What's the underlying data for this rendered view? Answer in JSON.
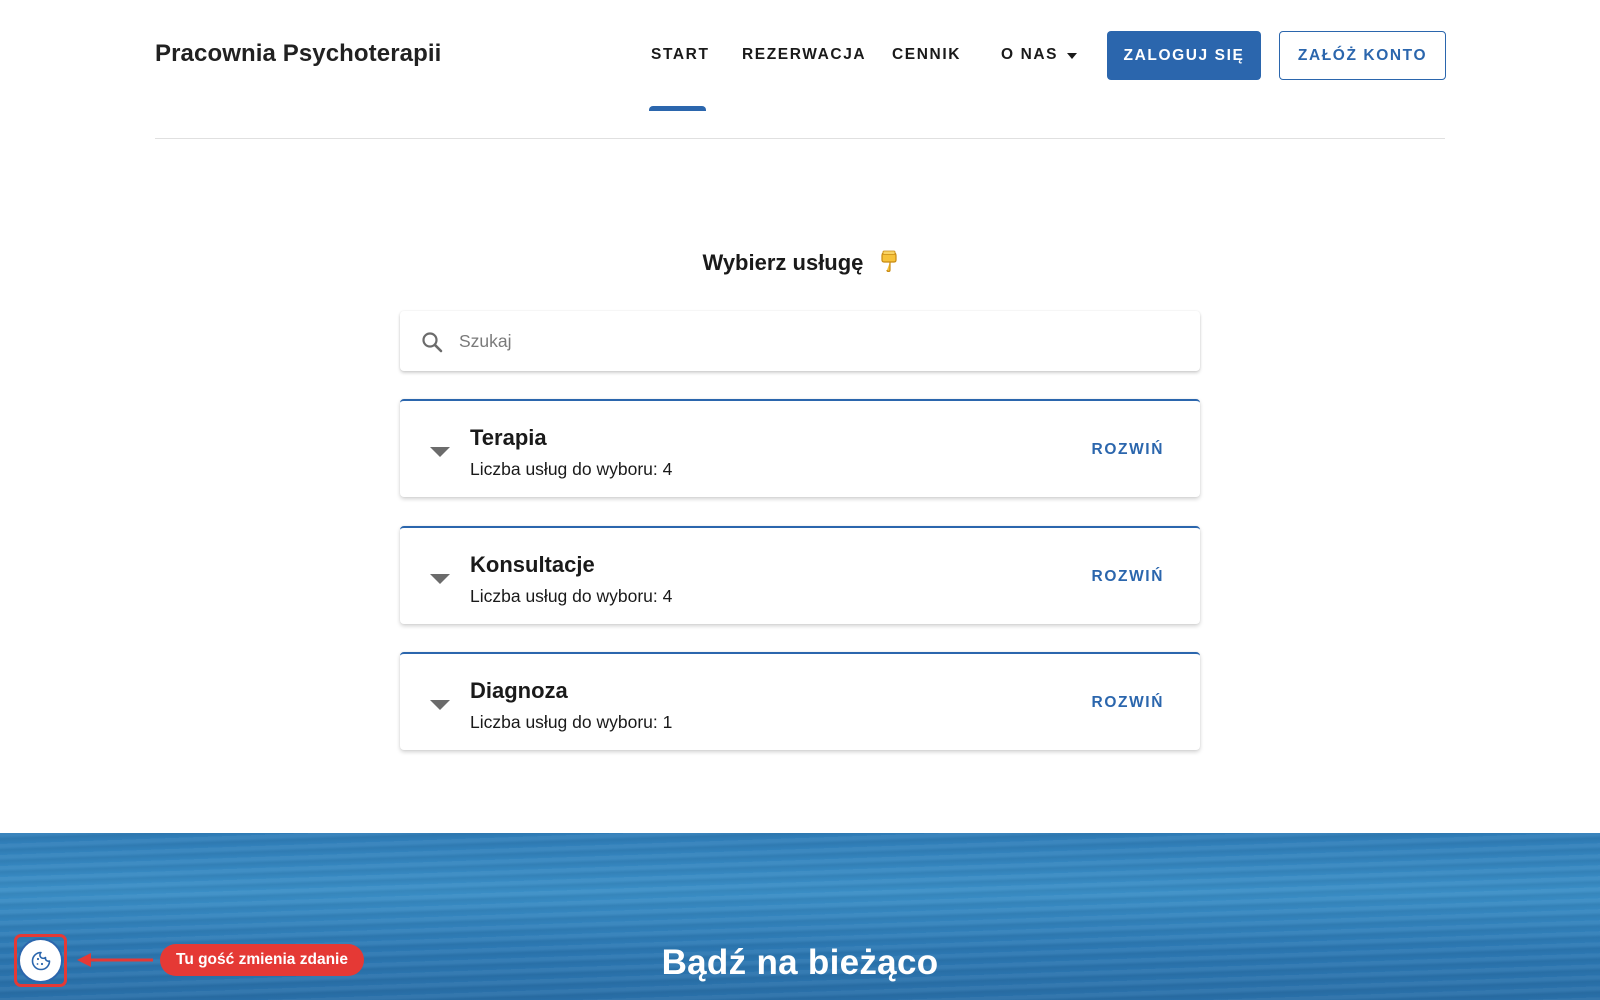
{
  "header": {
    "brand": "Pracownia Psychoterapii",
    "nav": [
      {
        "label": "START",
        "active": true
      },
      {
        "label": "REZERWACJA",
        "active": false
      },
      {
        "label": "CENNIK",
        "active": false
      },
      {
        "label": "O NAS",
        "active": false,
        "has_dropdown": true
      }
    ],
    "login_label": "ZALOGUJ SIĘ",
    "register_label": "ZAŁÓŻ KONTO"
  },
  "main": {
    "title": "Wybierz usługę",
    "title_icon": "pointing-down-hand-icon",
    "search": {
      "placeholder": "Szukaj",
      "value": "",
      "icon": "search-icon"
    },
    "services": [
      {
        "name": "Terapia",
        "count_text": "Liczba usług do wyboru: 4",
        "expand_label": "ROZWIŃ"
      },
      {
        "name": "Konsultacje",
        "count_text": "Liczba usług do wyboru: 4",
        "expand_label": "ROZWIŃ"
      },
      {
        "name": "Diagnoza",
        "count_text": "Liczba usług do wyboru: 1",
        "expand_label": "ROZWIŃ"
      }
    ]
  },
  "banner": {
    "title": "Bądź na bieżąco"
  },
  "cookie_widget": {
    "icon": "cookie-icon",
    "annotation": "Tu gość zmienia zdanie"
  },
  "colors": {
    "primary": "#2b66ad",
    "text": "#1a1a1a",
    "annotation": "#e53935",
    "banner": "#2f7db8"
  }
}
